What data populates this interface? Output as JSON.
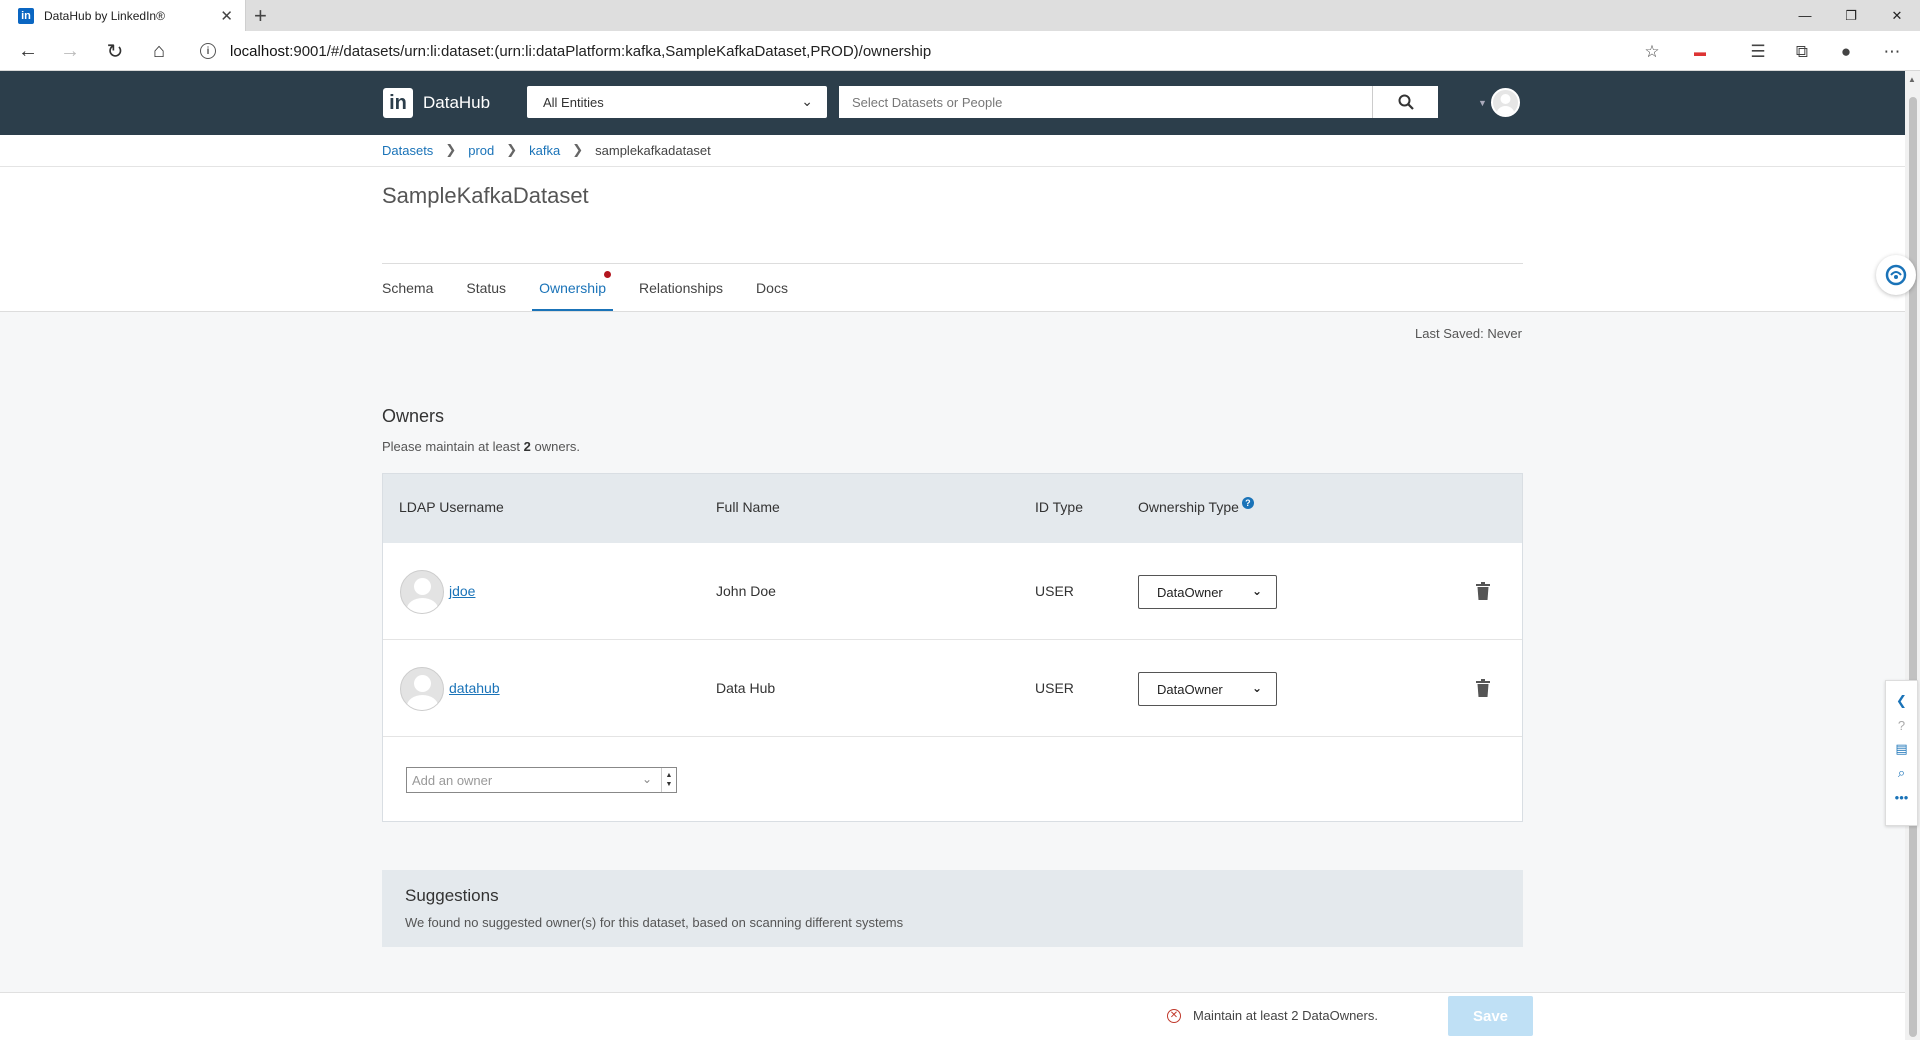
{
  "browser": {
    "tab_title": "DataHub by LinkedIn®",
    "favicon_text": "in",
    "new_tab": "+",
    "url_host": "localhost",
    "url_rest": ":9001/#/datasets/urn:li:dataset:(urn:li:dataPlatform:kafka,SampleKafkaDataset,PROD)/ownership"
  },
  "header": {
    "logo_text": "in",
    "app_name": "DataHub",
    "entity_select": "All Entities",
    "search_placeholder": "Select Datasets or People"
  },
  "breadcrumb": {
    "items": [
      "Datasets",
      "prod",
      "kafka"
    ],
    "current": "samplekafkadataset"
  },
  "page": {
    "title": "SampleKafkaDataset"
  },
  "tabs": [
    {
      "label": "Schema"
    },
    {
      "label": "Status"
    },
    {
      "label": "Ownership",
      "active": true,
      "alert": true
    },
    {
      "label": "Relationships"
    },
    {
      "label": "Docs"
    }
  ],
  "status": {
    "last_saved": "Last Saved: Never"
  },
  "owners": {
    "heading": "Owners",
    "hint_prefix": "Please maintain at least ",
    "hint_count": "2",
    "hint_suffix": " owners.",
    "columns": {
      "ldap": "LDAP Username",
      "full_name": "Full Name",
      "id_type": "ID Type",
      "ownership_type": "Ownership Type",
      "help": "?"
    },
    "rows": [
      {
        "username": "jdoe",
        "full_name": "John Doe",
        "id_type": "USER",
        "ownership_type": "DataOwner"
      },
      {
        "username": "datahub",
        "full_name": "Data Hub",
        "id_type": "USER",
        "ownership_type": "DataOwner"
      }
    ],
    "add_placeholder": "Add an owner"
  },
  "suggestions": {
    "title": "Suggestions",
    "text": "We found no suggested owner(s) for this dataset, based on scanning different systems"
  },
  "footer": {
    "error": "Maintain at least 2 DataOwners.",
    "save_label": "Save"
  },
  "colors": {
    "header_bg": "#2c3e4b",
    "link": "#1a73b8",
    "error": "#c0392b",
    "save_disabled": "#bfe0f5"
  }
}
